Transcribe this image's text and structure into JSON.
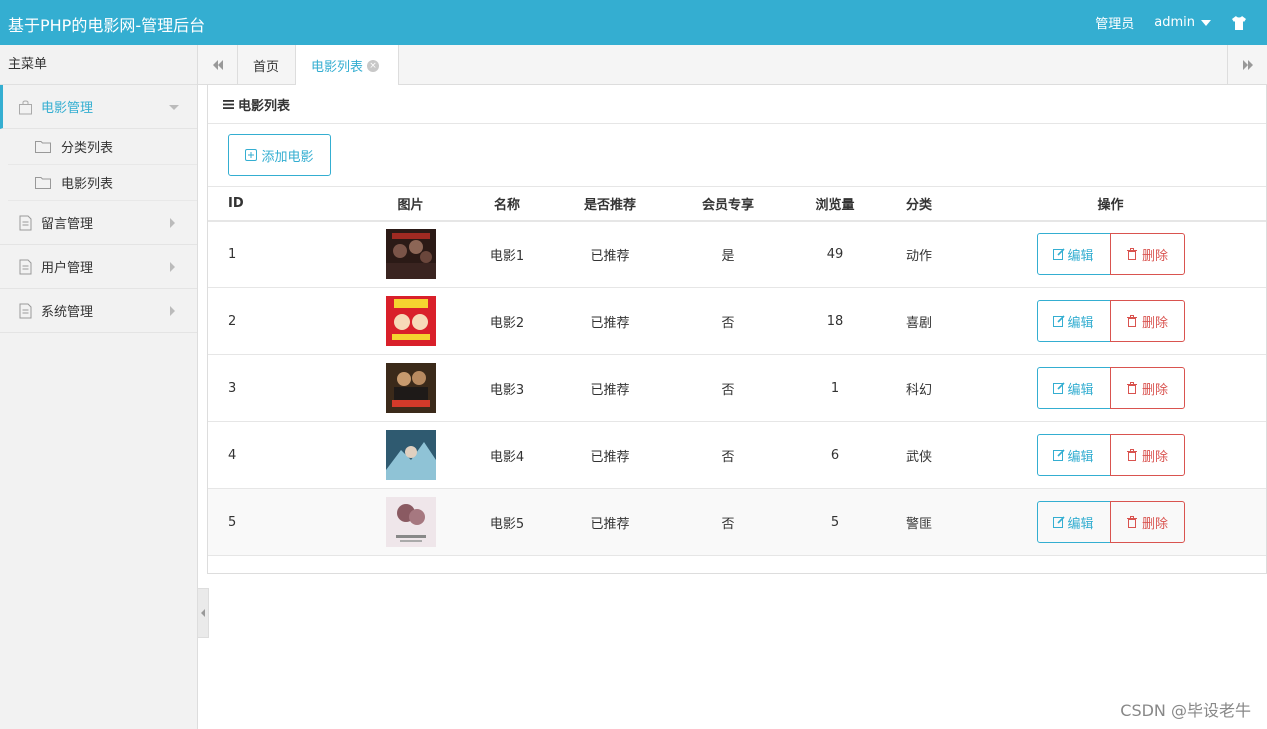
{
  "header": {
    "title": "基于PHP的电影网-管理后台",
    "admin_label": "管理员",
    "user": "admin"
  },
  "sidebar": {
    "header": "主菜单",
    "items": [
      {
        "label": "电影管理",
        "active": true,
        "subitems": [
          {
            "label": "分类列表"
          },
          {
            "label": "电影列表"
          }
        ]
      },
      {
        "label": "留言管理"
      },
      {
        "label": "用户管理"
      },
      {
        "label": "系统管理"
      }
    ]
  },
  "tabs": [
    {
      "label": "首页"
    },
    {
      "label": "电影列表",
      "active": true
    }
  ],
  "panel": {
    "title": "电影列表",
    "add_button": "添加电影"
  },
  "table": {
    "columns": [
      "ID",
      "图片",
      "名称",
      "是否推荐",
      "会员专享",
      "浏览量",
      "分类",
      "操作"
    ],
    "edit_label": "编辑",
    "delete_label": "删除",
    "rows": [
      {
        "id": "1",
        "name": "电影1",
        "recommended": "已推荐",
        "vip": "是",
        "views": "49",
        "category": "动作"
      },
      {
        "id": "2",
        "name": "电影2",
        "recommended": "已推荐",
        "vip": "否",
        "views": "18",
        "category": "喜剧"
      },
      {
        "id": "3",
        "name": "电影3",
        "recommended": "已推荐",
        "vip": "否",
        "views": "1",
        "category": "科幻"
      },
      {
        "id": "4",
        "name": "电影4",
        "recommended": "已推荐",
        "vip": "否",
        "views": "6",
        "category": "武侠"
      },
      {
        "id": "5",
        "name": "电影5",
        "recommended": "已推荐",
        "vip": "否",
        "views": "5",
        "category": "警匪"
      }
    ]
  },
  "colors": {
    "accent": "#34aed1",
    "danger": "#d9534f"
  },
  "watermark": "CSDN @毕设老牛"
}
